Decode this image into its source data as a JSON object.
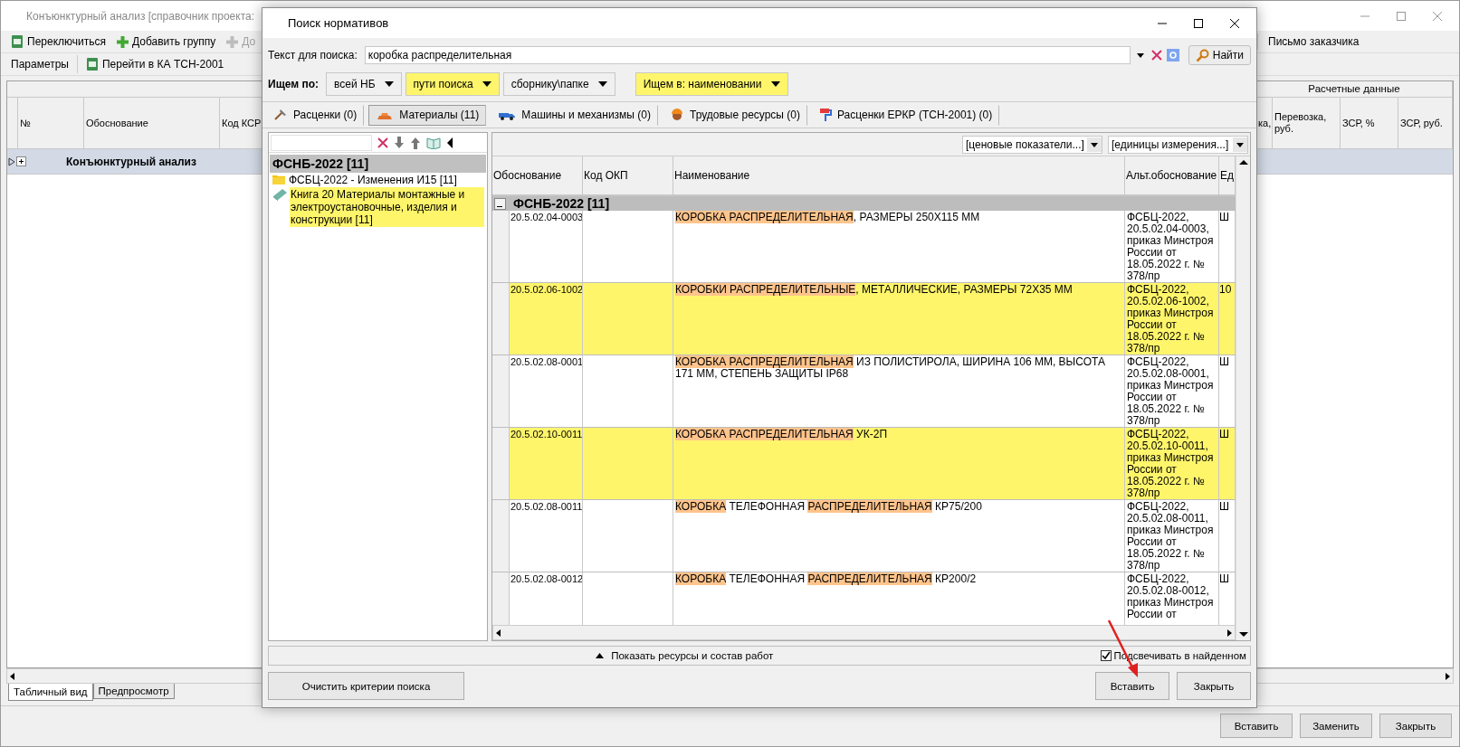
{
  "main_window": {
    "title": "Конъюнктурный анализ [справочник проекта:",
    "toolbar_1": [
      {
        "label": "Переключиться",
        "kind": "ka",
        "disabled": false
      },
      {
        "label": "Добавить группу",
        "kind": "add",
        "disabled": false
      },
      {
        "label": "До",
        "kind": "add",
        "disabled": true
      }
    ],
    "letter_button": "Письмо заказчика",
    "toolbar_2": [
      {
        "label": "Параметры",
        "kind": "text",
        "disabled": false
      },
      {
        "label": "Перейти в КА ТСН-2001",
        "kind": "ka",
        "disabled": false
      }
    ],
    "table": {
      "band_header": "Расчетные данные",
      "columns_left": [
        "№",
        "Обоснование",
        "Код КСР"
      ],
      "columns_right": [
        "ка,",
        "Перевозка, руб.",
        "ЗСР, %",
        "ЗСР, руб."
      ],
      "group_row": {
        "label": "Конъюнктурный анализ",
        "expanded": false
      }
    },
    "view_tabs": [
      {
        "label": "Табличный вид",
        "selected": true
      },
      {
        "label": "Предпросмотр",
        "selected": false
      }
    ],
    "buttons": [
      "Вставить",
      "Заменить",
      "Закрыть"
    ]
  },
  "dialog": {
    "title": "Поиск нормативов",
    "search": {
      "label": "Текст для поиска:",
      "value": "коробка распределительная",
      "find_button": "Найти"
    },
    "filters": {
      "label": "Ищем по:",
      "dropdowns": [
        {
          "label": "всей НБ",
          "highlighted": false
        },
        {
          "label": "пути поиска",
          "highlighted": true
        },
        {
          "label": "сборнику\\папке",
          "highlighted": false
        },
        {
          "label": "Ищем в: наименовании",
          "highlighted": true
        }
      ]
    },
    "tabs": [
      {
        "label": "Расценки (0)",
        "kind": "rates",
        "selected": false
      },
      {
        "label": "Материалы (11)",
        "kind": "materials",
        "selected": true
      },
      {
        "label": "Машины и механизмы (0)",
        "kind": "machines",
        "selected": false
      },
      {
        "label": "Трудовые ресурсы (0)",
        "kind": "labor",
        "selected": false
      },
      {
        "label": "Расценки ЕРКР (ТСН-2001) (0)",
        "kind": "roller",
        "selected": false
      }
    ],
    "tree": [
      {
        "label": "ФСНБ-2022 [11]",
        "kind": "root",
        "children": [
          {
            "label": "ФСБЦ-2022 - Изменения И15 [11]",
            "kind": "folder",
            "selected": false
          },
          {
            "label": "Книга 20 Материалы монтажные и электроустановочные, изделия и конструкции [11]",
            "kind": "book",
            "selected": true
          }
        ]
      }
    ],
    "grid": {
      "filters": [
        "[ценовые показатели...]",
        "[единицы измерения...]"
      ],
      "columns": [
        "Обоснование",
        "Код ОКП",
        "Наименование",
        "Альт.обоснование",
        "Ед"
      ],
      "group": {
        "label": "ФСНБ-2022 [11]",
        "expanded": true
      },
      "rows": [
        {
          "code": "20.5.02.04-0003",
          "name": [
            {
              "text": "КОРОБКА ",
              "match": true
            },
            {
              "text": "РАСПРЕДЕЛИТЕЛЬНАЯ",
              "match": true
            },
            {
              "text": ", РАЗМЕРЫ 250Х115 ММ",
              "match": false
            }
          ],
          "alt": "ФСБЦ-2022, 20.5.02.04-0003, приказ Минстроя России от 18.05.2022 г. № 378/пр",
          "unit": "Ш",
          "selected": false
        },
        {
          "code": "20.5.02.06-1002",
          "name": [
            {
              "text": "КОРОБКИ ",
              "match": true
            },
            {
              "text": "РАСПРЕДЕЛИТЕЛЬНЫЕ",
              "match": true
            },
            {
              "text": ", МЕТАЛЛИЧЕСКИЕ, РАЗМЕРЫ 72Х35 ММ",
              "match": false
            }
          ],
          "alt": "ФСБЦ-2022, 20.5.02.06-1002, приказ Минстроя России от 18.05.2022 г. № 378/пр",
          "unit": "10",
          "selected": true
        },
        {
          "code": "20.5.02.08-0001",
          "name": [
            {
              "text": "КОРОБКА ",
              "match": true
            },
            {
              "text": "РАСПРЕДЕЛИТЕЛЬНАЯ",
              "match": true
            },
            {
              "text": " ИЗ ПОЛИСТИРОЛА, ШИРИНА 106 ММ, ВЫСОТА 171 ММ, СТЕПЕНЬ ЗАЩИТЫ IP68",
              "match": false
            }
          ],
          "alt": "ФСБЦ-2022, 20.5.02.08-0001, приказ Минстроя России от 18.05.2022 г. № 378/пр",
          "unit": "Ш",
          "selected": false
        },
        {
          "code": "20.5.02.10-0011",
          "name": [
            {
              "text": "КОРОБКА ",
              "match": true
            },
            {
              "text": "РАСПРЕДЕЛИТЕЛЬНАЯ",
              "match": true
            },
            {
              "text": " УК-2П",
              "match": false
            }
          ],
          "alt": "ФСБЦ-2022, 20.5.02.10-0011, приказ Минстроя России от 18.05.2022 г. № 378/пр",
          "unit": "Ш",
          "selected": true
        },
        {
          "code": "20.5.02.08-0011",
          "name": [
            {
              "text": "КОРОБКА",
              "match": true
            },
            {
              "text": " ТЕЛЕФОННАЯ ",
              "match": false
            },
            {
              "text": "РАСПРЕДЕЛИТЕЛЬНАЯ",
              "match": true
            },
            {
              "text": " КР75/200",
              "match": false
            }
          ],
          "alt": "ФСБЦ-2022, 20.5.02.08-0011, приказ Минстроя России от 18.05.2022 г. № 378/пр",
          "unit": "Ш",
          "selected": false
        },
        {
          "code": "20.5.02.08-0012",
          "name": [
            {
              "text": "КОРОБКА",
              "match": true
            },
            {
              "text": " ТЕЛЕФОННАЯ ",
              "match": false
            },
            {
              "text": "РАСПРЕДЕЛИТЕЛЬНАЯ",
              "match": true
            },
            {
              "text": " КР200/2",
              "match": false
            }
          ],
          "alt": "ФСБЦ-2022, 20.5.02.08-0012, приказ Минстроя России от",
          "unit": "Ш",
          "selected": false
        }
      ]
    },
    "footer": {
      "show_button": "Показать ресурсы и состав работ",
      "highlight_checkbox": {
        "label": "Подсвечивать в найденном",
        "checked": true
      }
    },
    "buttons": {
      "clear": "Очистить критерии поиска",
      "insert": "Вставить",
      "close": "Закрыть"
    }
  }
}
